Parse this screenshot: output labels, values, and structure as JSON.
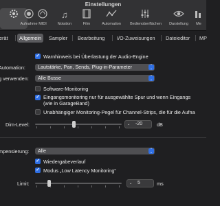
{
  "window": {
    "title": "Einstellungen"
  },
  "toolbar": {
    "items": [
      {
        "label": "",
        "icon": "gear-icon"
      },
      {
        "label": "Aufnahme",
        "icon": "record-icon"
      },
      {
        "label": "MIDI",
        "icon": "midi-icon"
      },
      {
        "label": "Notation",
        "icon": "notation-icon"
      },
      {
        "label": "Film",
        "icon": "film-icon"
      },
      {
        "label": "Automation",
        "icon": "automation-icon"
      },
      {
        "label": "Bedienoberflächen",
        "icon": "control-surfaces-icon"
      },
      {
        "label": "Darstellung",
        "icon": "display-icon"
      },
      {
        "label": "Me",
        "icon": "meter-icon"
      }
    ],
    "selected_index": 0
  },
  "tabs": {
    "items": [
      "erät",
      "Allgemein",
      "Sampler",
      "Bearbeitung",
      "I/O-Zuweisungen",
      "Dateieditor",
      "MP"
    ],
    "selected_index": 1
  },
  "general": {
    "cb_warning": {
      "label": "Warnhinweis bei Überlastung der Audio-Engine",
      "checked": true
    },
    "automation_label": "Automation:",
    "automation_value": "Lautstärke, Pan, Sends, Plug-in-Parameter",
    "busses_label": "g verwenden:",
    "busses_value": "Alle Busse",
    "cb_software": {
      "label": "Software-Monitoring",
      "checked": false
    },
    "cb_input_line1": "Eingangsmonitoring nur für ausgewählte Spur und wenn Eingangs",
    "cb_input_line2": "(wie in GarageBand)",
    "cb_input_checked": true,
    "cb_independent": {
      "label": "Unabhängiger Monitoring-Pegel für Channel-Strips, die für die Aufna",
      "checked": false
    },
    "dim_label": "Dim-Level:",
    "dim_value": "-20",
    "dim_level": 0.45,
    "dim_unit": "dB"
  },
  "plugin_latency": {
    "comp_label": "mpensierung:",
    "comp_value": "Alle",
    "cb_playback": {
      "label": "Wiedergabeverlauf",
      "checked": true
    },
    "cb_low_latency": {
      "label": "Modus „Low Latency Monitoring“",
      "checked": true
    },
    "limit_label": "Limit:",
    "limit_value": "5",
    "limit_level": 0.15,
    "limit_unit": "ms"
  },
  "colors": {
    "accent": "#2f6fe4",
    "background": "#1f1f21",
    "toolbar": "#323234"
  }
}
